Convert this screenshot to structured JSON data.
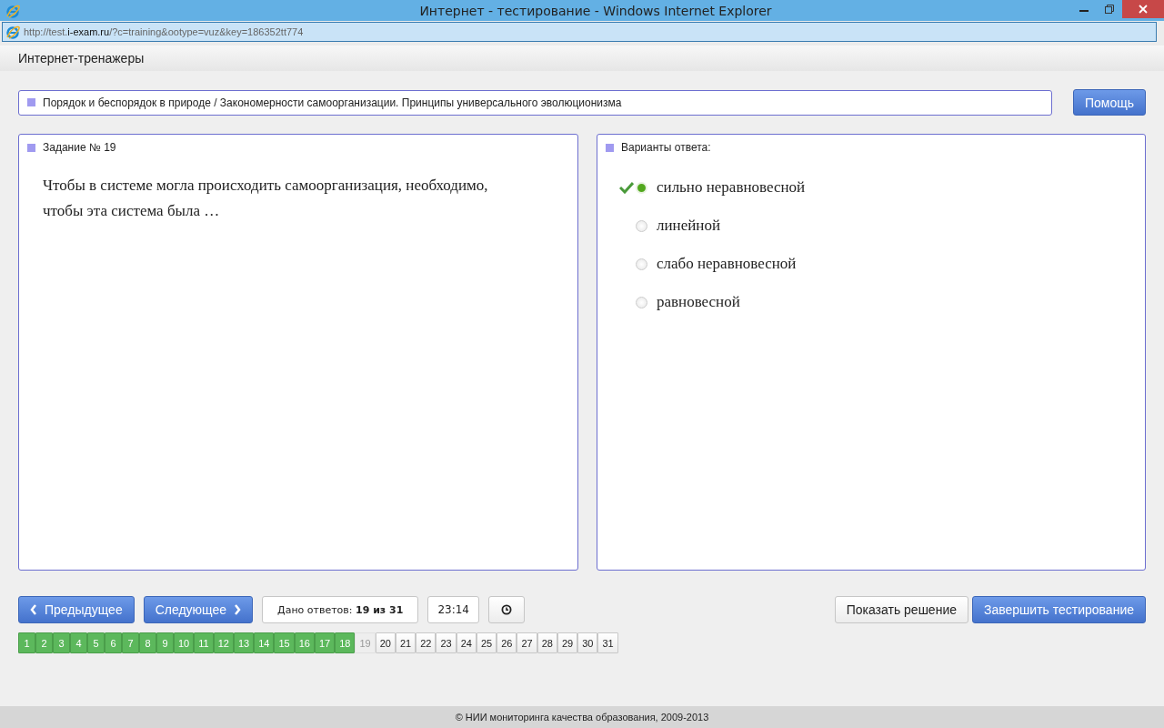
{
  "window": {
    "title": "Интернет - тестирование - Windows Internet Explorer"
  },
  "address_bar": {
    "url_parts": [
      {
        "text": "http://test.",
        "emphasis": false
      },
      {
        "text": "i-exam.ru",
        "emphasis": true
      },
      {
        "text": "/?c=training&ootype=vuz&key=186352tt774",
        "emphasis": false
      }
    ]
  },
  "site_header": {
    "title": "Интернет-тренажеры"
  },
  "topic": {
    "text": "Порядок и беспорядок в природе / Закономерности самоорганизации. Принципы универсального эволюционизма"
  },
  "help_button": "Помощь",
  "question": {
    "heading": "Задание № 19",
    "text": "Чтобы в системе могла происходить самоорганизация, необходимо, чтобы эта система была …"
  },
  "answers": {
    "heading": "Варианты ответа:",
    "options": [
      {
        "label": "сильно неравновесной",
        "selected": true,
        "correct": true
      },
      {
        "label": "линейной",
        "selected": false,
        "correct": false
      },
      {
        "label": "слабо неравновесной",
        "selected": false,
        "correct": false
      },
      {
        "label": "равновесной",
        "selected": false,
        "correct": false
      }
    ]
  },
  "navigation": {
    "previous": "Предыдущее",
    "next": "Следующее",
    "answered_count": "Дано ответов: **19 из 31**",
    "timer": "23:14",
    "show_solution": "Показать решение",
    "finish": "Завершить тестирование"
  },
  "pages": [
    {
      "label": "1",
      "answered": true,
      "selected": false
    },
    {
      "label": "2",
      "answered": true,
      "selected": false
    },
    {
      "label": "3",
      "answered": true,
      "selected": false
    },
    {
      "label": "4",
      "answered": true,
      "selected": false
    },
    {
      "label": "5",
      "answered": true,
      "selected": false
    },
    {
      "label": "6",
      "answered": true,
      "selected": false
    },
    {
      "label": "7",
      "answered": true,
      "selected": false
    },
    {
      "label": "8",
      "answered": true,
      "selected": false
    },
    {
      "label": "9",
      "answered": true,
      "selected": false
    },
    {
      "label": "10",
      "answered": true,
      "selected": false
    },
    {
      "label": "11",
      "answered": true,
      "selected": false
    },
    {
      "label": "12",
      "answered": true,
      "selected": false
    },
    {
      "label": "13",
      "answered": true,
      "selected": false
    },
    {
      "label": "14",
      "answered": true,
      "selected": false
    },
    {
      "label": "15",
      "answered": true,
      "selected": false
    },
    {
      "label": "16",
      "answered": true,
      "selected": false
    },
    {
      "label": "17",
      "answered": true,
      "selected": false
    },
    {
      "label": "18",
      "answered": true,
      "selected": false
    },
    {
      "label": "19",
      "answered": false,
      "selected": true
    },
    {
      "label": "20",
      "answered": false,
      "selected": false
    },
    {
      "label": "21",
      "answered": false,
      "selected": false
    },
    {
      "label": "22",
      "answered": false,
      "selected": false
    },
    {
      "label": "23",
      "answered": false,
      "selected": false
    },
    {
      "label": "24",
      "answered": false,
      "selected": false
    },
    {
      "label": "25",
      "answered": false,
      "selected": false
    },
    {
      "label": "26",
      "answered": false,
      "selected": false
    },
    {
      "label": "27",
      "answered": false,
      "selected": false
    },
    {
      "label": "28",
      "answered": false,
      "selected": false
    },
    {
      "label": "29",
      "answered": false,
      "selected": false
    },
    {
      "label": "30",
      "answered": false,
      "selected": false
    },
    {
      "label": "31",
      "answered": false,
      "selected": false
    }
  ],
  "footer": "© НИИ мониторинга качества образования, 2009-2013"
}
